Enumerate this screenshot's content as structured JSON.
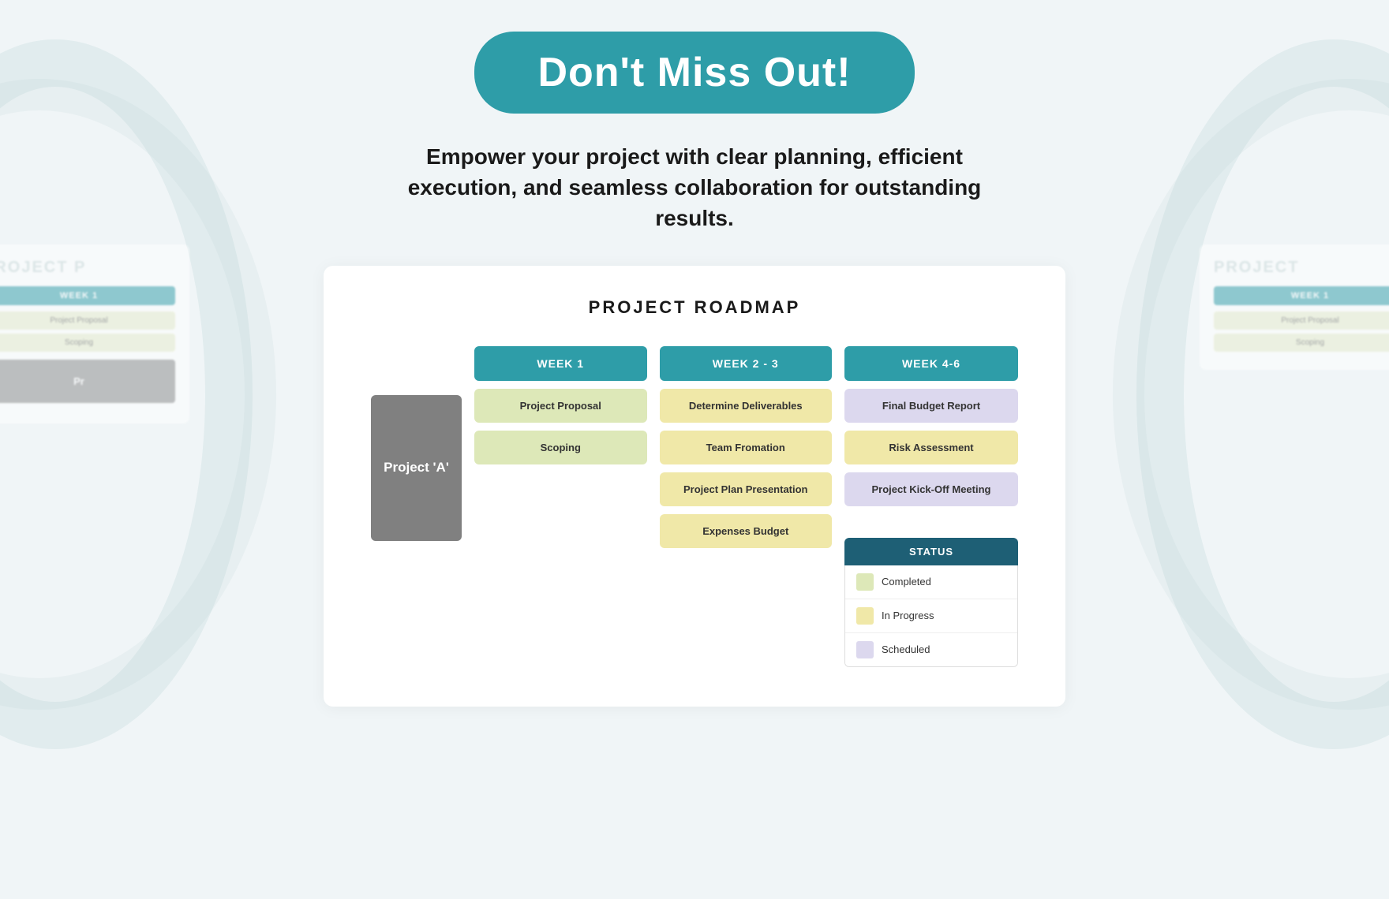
{
  "hero": {
    "button_label": "Don't Miss Out!",
    "subtitle": "Empower your project with clear planning, efficient execution, and seamless collaboration for outstanding results."
  },
  "roadmap": {
    "title": "PROJECT ROADMAP",
    "project_label": "Project 'A'",
    "weeks": [
      {
        "header": "WEEK 1",
        "tasks": [
          {
            "label": "Project Proposal",
            "style": "green"
          },
          {
            "label": "Scoping",
            "style": "green"
          }
        ]
      },
      {
        "header": "WEEK 2 - 3",
        "tasks": [
          {
            "label": "Determine Deliverables",
            "style": "yellow"
          },
          {
            "label": "Team Fromation",
            "style": "yellow"
          },
          {
            "label": "Project Plan Presentation",
            "style": "yellow"
          },
          {
            "label": "Expenses Budget",
            "style": "yellow"
          }
        ]
      },
      {
        "header": "WEEK 4-6",
        "tasks": [
          {
            "label": "Final Budget Report",
            "style": "purple"
          },
          {
            "label": "Risk Assessment",
            "style": "yellow"
          },
          {
            "label": "Project Kick-Off Meeting",
            "style": "purple"
          }
        ]
      }
    ],
    "status": {
      "header": "STATUS",
      "items": [
        {
          "label": "Completed",
          "color": "#dde8b8"
        },
        {
          "label": "In Progress",
          "color": "#f0e8a8"
        },
        {
          "label": "Scheduled",
          "color": "#dcd8ee"
        }
      ]
    }
  },
  "side_left": {
    "title": "PROJECT P",
    "week_label": "WEEK 1",
    "tasks": [
      "Project Proposal",
      "Scoping"
    ],
    "project_box": "Pr"
  },
  "side_right": {
    "title": "PROJECT",
    "week_label": "WEEK 1",
    "tasks": [
      "Project Proposal",
      "Scoping"
    ]
  }
}
